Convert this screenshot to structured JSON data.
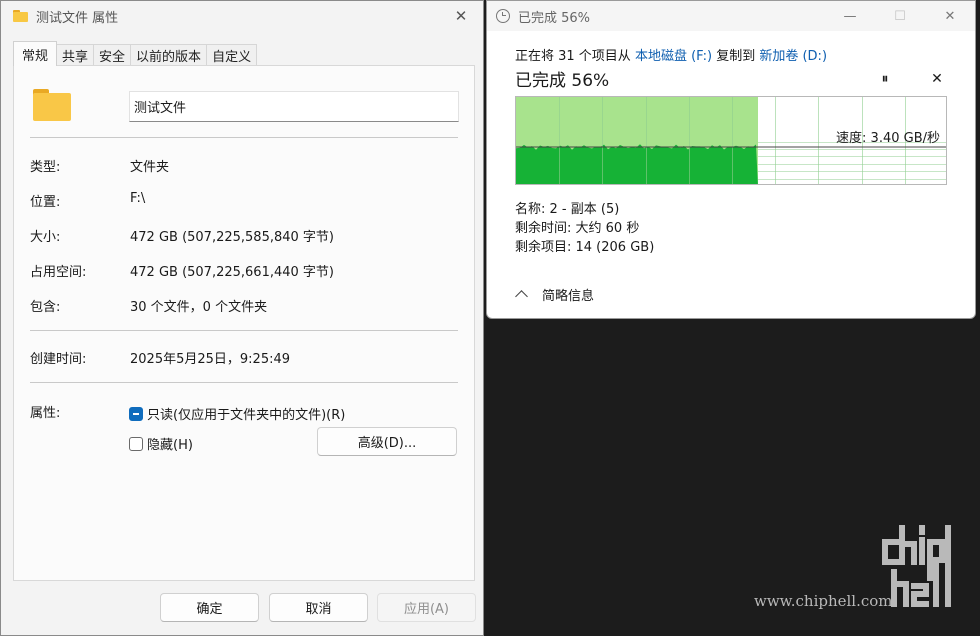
{
  "props_window": {
    "title": "测试文件 属性",
    "tabs": [
      "常规",
      "共享",
      "安全",
      "以前的版本",
      "自定义"
    ],
    "name": "测试文件",
    "rows": [
      {
        "label": "类型:",
        "value": "文件夹"
      },
      {
        "label": "位置:",
        "value": "F:\\"
      },
      {
        "label": "大小:",
        "value": "472 GB (507,225,585,840 字节)"
      },
      {
        "label": "占用空间:",
        "value": "472 GB (507,225,661,440 字节)"
      },
      {
        "label": "包含:",
        "value": "30 个文件，0 个文件夹"
      }
    ],
    "created_label": "创建时间:",
    "created_value": "2025年5月25日，9:25:49",
    "attributes_label": "属性:",
    "readonly_label": "只读(仅应用于文件夹中的文件)(R)",
    "hidden_label": "隐藏(H)",
    "advanced_button": "高级(D)...",
    "ok_button": "确定",
    "cancel_button": "取消",
    "apply_button": "应用(A)"
  },
  "copy_window": {
    "title": "已完成 56%",
    "line_prefix": "正在将 31 个项目从 ",
    "source": "本地磁盘 (F:)",
    "line_middle": " 复制到 ",
    "dest": "新加卷 (D:)",
    "progress_title": "已完成 56%",
    "progress_percent": 56,
    "speed_label": "速度: 3.40 GB/秒",
    "name_line": "名称:  2 - 副本 (5)",
    "time_line": "剩余时间:  大约 60 秒",
    "items_line": "剩余项目:  14 (206 GB)",
    "details_label": "简略信息",
    "colors": {
      "fill_light": "#a8e38d",
      "fill_dark": "#16b236",
      "grid": "#8fce8f"
    }
  },
  "watermark": {
    "logo_text": "chip hell",
    "url": "www.chiphell.com"
  }
}
